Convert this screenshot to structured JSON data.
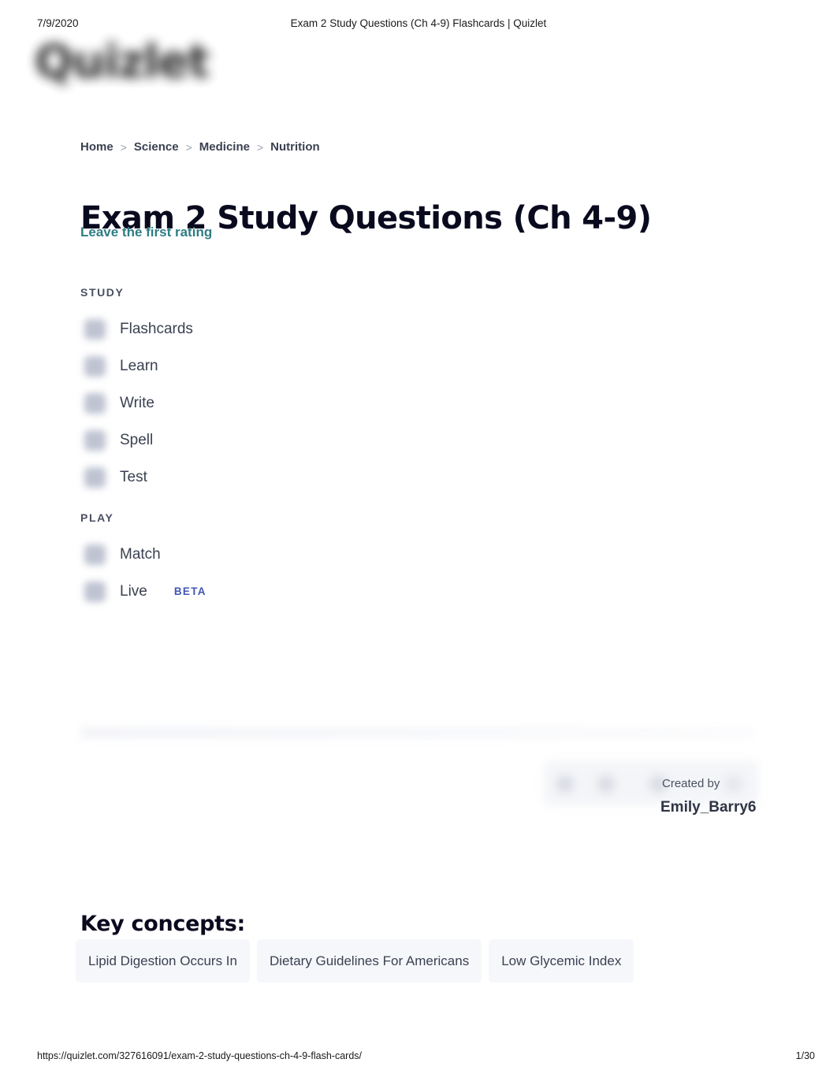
{
  "print": {
    "date": "7/9/2020",
    "doc_title": "Exam 2 Study Questions (Ch 4-9) Flashcards | Quizlet",
    "url": "https://quizlet.com/327616091/exam-2-study-questions-ch-4-9-flash-cards/",
    "page_indicator": "1/30"
  },
  "brand": {
    "logo_text": "Quizlet"
  },
  "breadcrumb": {
    "items": [
      {
        "label": "Home"
      },
      {
        "label": "Science"
      },
      {
        "label": "Medicine"
      },
      {
        "label": "Nutrition"
      }
    ],
    "separator": ">"
  },
  "header": {
    "title": "Exam 2 Study Questions (Ch 4-9)",
    "rating_link": "Leave the first rating"
  },
  "study": {
    "label": "STUDY",
    "items": [
      {
        "label": "Flashcards",
        "icon": "flashcards-icon"
      },
      {
        "label": "Learn",
        "icon": "learn-icon"
      },
      {
        "label": "Write",
        "icon": "write-icon"
      },
      {
        "label": "Spell",
        "icon": "spell-icon"
      },
      {
        "label": "Test",
        "icon": "test-icon"
      }
    ]
  },
  "play": {
    "label": "PLAY",
    "items": [
      {
        "label": "Match",
        "icon": "match-icon",
        "badge": ""
      },
      {
        "label": "Live",
        "icon": "live-icon",
        "badge": "BETA"
      }
    ]
  },
  "creator": {
    "created_by_label": "Created by",
    "username": "Emily_Barry6"
  },
  "key_concepts": {
    "title": "Key concepts:",
    "chips": [
      {
        "label": "Lipid Digestion Occurs In"
      },
      {
        "label": "Dietary Guidelines For Americans"
      },
      {
        "label": "Low Glycemic Index"
      }
    ]
  },
  "colors": {
    "teal_link": "#2e7d83",
    "beta_badge": "#4257b2",
    "text_primary": "#0a0a1f",
    "text_body": "#3a4151",
    "chip_bg": "#f6f7fb"
  }
}
